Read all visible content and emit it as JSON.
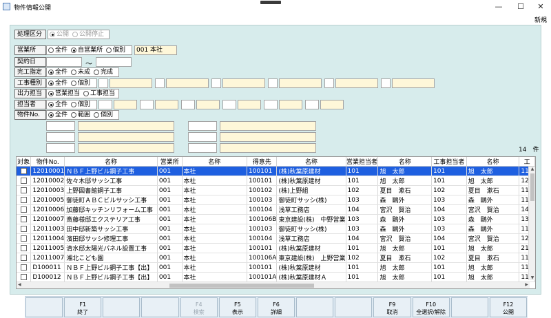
{
  "window": {
    "title": "物件情報公開",
    "controls": {
      "minimize": "—",
      "maximize": "☐",
      "close": "✕"
    }
  },
  "menu": {
    "new": "新規"
  },
  "form": {
    "shori_kubun": {
      "label": "処理区分",
      "options": [
        "公開",
        "公開停止"
      ],
      "selected": 0
    },
    "eigyosho": {
      "label": "営業所",
      "options": [
        "全件",
        "自営業所",
        "個別"
      ],
      "selected": 1,
      "value": "001 本社"
    },
    "keiyakubi": {
      "label": "契約日",
      "from": "",
      "to": "",
      "separator": "～"
    },
    "kanryo": {
      "label": "完工指定",
      "options": [
        "全件",
        "未成",
        "完成"
      ],
      "selected": 0
    },
    "koji_shubetsu": {
      "label": "工事種別",
      "options": [
        "全件",
        "個別"
      ],
      "selected": 0
    },
    "shutsuryoku_tanto": {
      "label": "出力担当",
      "options": [
        "営業担当",
        "工事担当"
      ],
      "selected": 0
    },
    "tantosha": {
      "label": "担当者",
      "options": [
        "全件",
        "個別"
      ],
      "selected": 0
    },
    "bukken_no": {
      "label": "物件No.",
      "options": [
        "全件",
        "範囲",
        "個別"
      ],
      "selected": 0
    }
  },
  "count": "14　件",
  "grid": {
    "columns": [
      "対象",
      "物件No.",
      "名称",
      "営業所",
      "名称",
      "得意先",
      "名称",
      "営業担当者",
      "名称",
      "工事担当者",
      "名称",
      "工"
    ],
    "rows": [
      {
        "no": "12010001",
        "name": "ＮＢＦ上野ビル鋼子工事",
        "office": "001",
        "office_name": "本社",
        "client": "100101",
        "client_name": "(株)秋葉原建材",
        "sales": "101",
        "sales_name": "旭　太郎",
        "const": "101",
        "const_name": "旭　太郎",
        "k": "11"
      },
      {
        "no": "12010002",
        "name": "佐々木邸サッシ工事",
        "office": "001",
        "office_name": "本社",
        "client": "100101",
        "client_name": "(株)秋葉原建材",
        "sales": "101",
        "sales_name": "旭　太郎",
        "const": "101",
        "const_name": "旭　太郎",
        "k": "12"
      },
      {
        "no": "12010003",
        "name": "上野図書館鋼子工事",
        "office": "001",
        "office_name": "本社",
        "client": "100102",
        "client_name": "(株)上野組",
        "sales": "102",
        "sales_name": "夏目　漱石",
        "const": "102",
        "const_name": "夏目　漱石",
        "k": "11"
      },
      {
        "no": "12010005",
        "name": "御徒町ＡＢＣビルサッシ工事",
        "office": "001",
        "office_name": "本社",
        "client": "100103",
        "client_name": "御徒町サッシ(株)",
        "sales": "103",
        "sales_name": "森　鷗外",
        "const": "103",
        "const_name": "森　鷗外",
        "k": "11"
      },
      {
        "no": "12010006",
        "name": "加藤邸キッチンリフォーム工事",
        "office": "001",
        "office_name": "本社",
        "client": "100104",
        "client_name": "浅草工務店",
        "sales": "104",
        "sales_name": "宮沢　賢治",
        "const": "104",
        "const_name": "宮沢　賢治",
        "k": "14"
      },
      {
        "no": "12010007",
        "name": "斎藤様邸エクステリア工事",
        "office": "001",
        "office_name": "本社",
        "client": "100106B",
        "client_name": "東京建設(株)　中野営業",
        "sales": "103",
        "sales_name": "森　鷗外",
        "const": "103",
        "const_name": "森　鷗外",
        "k": "13"
      },
      {
        "no": "12011003",
        "name": "田中邸新築サッシ工事",
        "office": "001",
        "office_name": "本社",
        "client": "100103",
        "client_name": "御徒町サッシ(株)",
        "sales": "103",
        "sales_name": "森　鷗外",
        "const": "103",
        "const_name": "森　鷗外",
        "k": "11"
      },
      {
        "no": "12011004",
        "name": "濱田邸サッシ修理工事",
        "office": "001",
        "office_name": "本社",
        "client": "100104",
        "client_name": "浅草工務店",
        "sales": "104",
        "sales_name": "宮沢　賢治",
        "const": "104",
        "const_name": "宮沢　賢治",
        "k": "12"
      },
      {
        "no": "12011005",
        "name": "清水邸太陽光パネル設置工事",
        "office": "001",
        "office_name": "本社",
        "client": "100101",
        "client_name": "(株)秋葉原建材",
        "sales": "101",
        "sales_name": "旭　太郎",
        "const": "101",
        "const_name": "旭　太郎",
        "k": "21"
      },
      {
        "no": "12011007",
        "name": "湘北こども園",
        "office": "001",
        "office_name": "本社",
        "client": "100106A",
        "client_name": "東京建設(株)　上野営業",
        "sales": "102",
        "sales_name": "夏目　漱石",
        "const": "102",
        "const_name": "夏目　漱石",
        "k": "11"
      },
      {
        "no": "D100011",
        "name": "ＮＢＦ上野ビル鋼子工事【出】",
        "office": "001",
        "office_name": "本社",
        "client": "100101",
        "client_name": "(株)秋葉原建材",
        "sales": "101",
        "sales_name": "旭　太郎",
        "const": "101",
        "const_name": "旭　太郎",
        "k": "11"
      },
      {
        "no": "D100012",
        "name": "ＮＢＦ上野ビル鋼子工事【出】",
        "office": "001",
        "office_name": "本社",
        "client": "100101A",
        "client_name": "(株)秋葉原建材Ａ",
        "sales": "101",
        "sales_name": "旭　太郎",
        "const": "101",
        "const_name": "旭　太郎",
        "k": "11"
      }
    ]
  },
  "fkeys": [
    {
      "label": "",
      "disabled": false
    },
    {
      "label": "F1\n終了",
      "disabled": false
    },
    {
      "label": "",
      "disabled": false
    },
    {
      "label": "",
      "disabled": false
    },
    {
      "label": "F4\n検索",
      "disabled": true
    },
    {
      "label": "F5\n表示",
      "disabled": false
    },
    {
      "label": "F6\n詳細",
      "disabled": false
    },
    {
      "label": "",
      "disabled": false
    },
    {
      "label": "",
      "disabled": false
    },
    {
      "label": "F9\n取消",
      "disabled": false
    },
    {
      "label": "F10\n全選択/解除",
      "disabled": false
    },
    {
      "label": "",
      "disabled": false
    },
    {
      "label": "F12\n公開",
      "disabled": false
    }
  ]
}
